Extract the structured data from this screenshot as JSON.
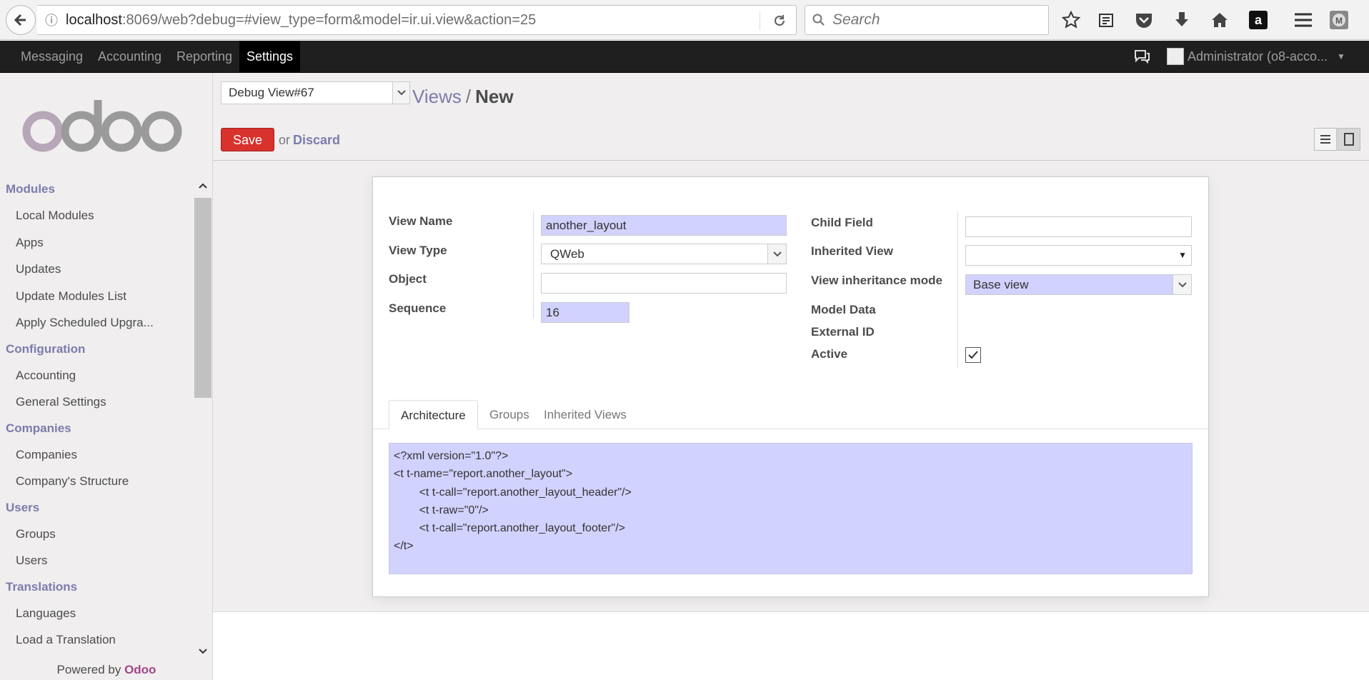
{
  "browser": {
    "url_host": "localhost",
    "url_port": ":8069",
    "url_path": "/web?debug=#view_type=form&model=ir.ui.view&action=25",
    "search_placeholder": "Search"
  },
  "topnav": {
    "items": [
      {
        "label": "Messaging"
      },
      {
        "label": "Accounting"
      },
      {
        "label": "Reporting"
      },
      {
        "label": "Settings"
      }
    ],
    "user_name": "Administrator (o8-acco..."
  },
  "sidebar": {
    "sections": [
      {
        "title": "Modules",
        "items": [
          "Local Modules",
          "Apps",
          "Updates",
          "Update Modules List",
          "Apply Scheduled Upgra..."
        ]
      },
      {
        "title": "Configuration",
        "items": [
          "Accounting",
          "General Settings"
        ]
      },
      {
        "title": "Companies",
        "items": [
          "Companies",
          "Company's Structure"
        ]
      },
      {
        "title": "Users",
        "items": [
          "Groups",
          "Users"
        ]
      },
      {
        "title": "Translations",
        "items": [
          "Languages",
          "Load a Translation"
        ]
      }
    ],
    "powered_by": "Powered by",
    "powered_brand": "Odoo"
  },
  "control_panel": {
    "debug_select": "Debug View#67",
    "breadcrumb_parent": "Views",
    "breadcrumb_sep": "/",
    "breadcrumb_current": "New",
    "save_label": "Save",
    "or_label": "or",
    "discard_label": "Discard"
  },
  "form": {
    "labels": {
      "view_name": "View Name",
      "view_type": "View Type",
      "object": "Object",
      "sequence": "Sequence",
      "child_field": "Child Field",
      "inherited_view": "Inherited View",
      "view_inheritance_mode": "View inheritance mode",
      "model_data": "Model Data",
      "external_id": "External ID",
      "active": "Active"
    },
    "values": {
      "view_name": "another_layout",
      "view_type": "QWeb",
      "object": "",
      "sequence": "16",
      "child_field": "",
      "inherited_view": "",
      "view_inheritance_mode": "Base view",
      "active": true
    },
    "tabs": [
      "Architecture",
      "Groups",
      "Inherited Views"
    ],
    "architecture": "<?xml version=\"1.0\"?>\n<t t-name=\"report.another_layout\">\n        <t t-call=\"report.another_layout_header\"/>\n        <t t-raw=\"0\"/>\n        <t t-call=\"report.another_layout_footer\"/>\n</t>"
  },
  "colors": {
    "odoo_purple": "#7c7bad",
    "save_red": "#d9312b",
    "required_field": "#d2d2ff",
    "topnav_bg": "#1f1f1f"
  }
}
